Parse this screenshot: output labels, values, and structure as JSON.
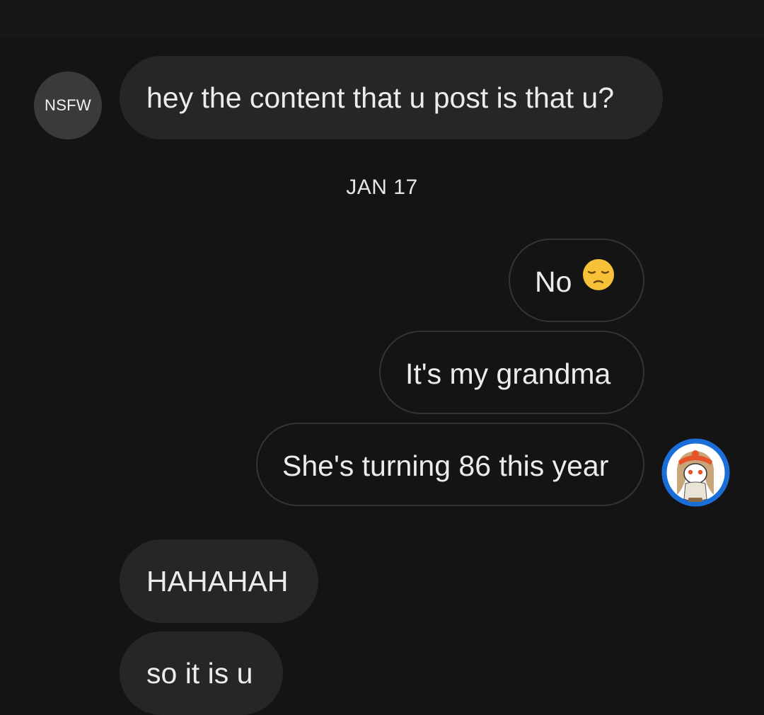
{
  "conversation": {
    "contact_avatar_text": "NSFW",
    "date_separator": "JAN 17",
    "messages": [
      {
        "sender": "them",
        "text": "hey the content that u post is that u?"
      },
      {
        "sender": "me",
        "text": "No",
        "emoji": "pensive-face"
      },
      {
        "sender": "me",
        "text": "It's my grandma"
      },
      {
        "sender": "me",
        "text": "She's turning 86 this year"
      },
      {
        "sender": "them",
        "text": "HAHAHAH"
      },
      {
        "sender": "them",
        "text": "so it is u"
      }
    ]
  },
  "colors": {
    "background": "#141414",
    "incoming_bubble": "#262626",
    "outgoing_border": "#343434",
    "text": "#ececec",
    "avatar_ring": "#1a6ed8",
    "emoji_yellow": "#f7c23a"
  },
  "icons": {
    "my_avatar": "user-avatar-icon",
    "emoji": "pensive-face-icon"
  }
}
